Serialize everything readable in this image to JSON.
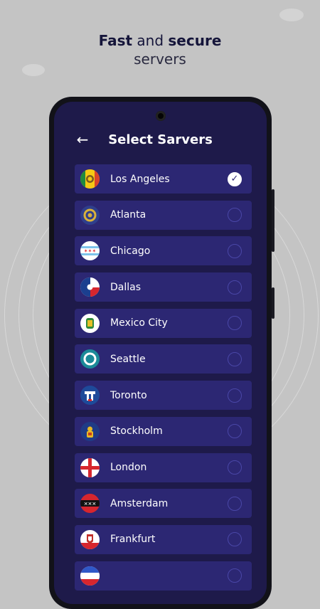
{
  "headline": {
    "part1": "Fast",
    "part2": " and ",
    "part3": "secure",
    "line2": "servers"
  },
  "app": {
    "back_icon": "arrow-left-icon",
    "title": "Select Sarvers",
    "selected_check": "✓"
  },
  "servers": [
    {
      "city": "Los Angeles",
      "selected": true
    },
    {
      "city": "Atlanta",
      "selected": false
    },
    {
      "city": "Chicago",
      "selected": false
    },
    {
      "city": "Dallas",
      "selected": false
    },
    {
      "city": "Mexico City",
      "selected": false
    },
    {
      "city": "Seattle",
      "selected": false
    },
    {
      "city": "Toronto",
      "selected": false
    },
    {
      "city": "Stockholm",
      "selected": false
    },
    {
      "city": "London",
      "selected": false
    },
    {
      "city": "Amsterdam",
      "selected": false
    },
    {
      "city": "Frankfurt",
      "selected": false
    },
    {
      "city": "",
      "selected": false
    }
  ],
  "colors": {
    "background": "#c4c4c4",
    "screen": "#1e1a4a",
    "row": "#2c2773",
    "radio_border": "#4a47a8",
    "title_text": "#15153a"
  }
}
